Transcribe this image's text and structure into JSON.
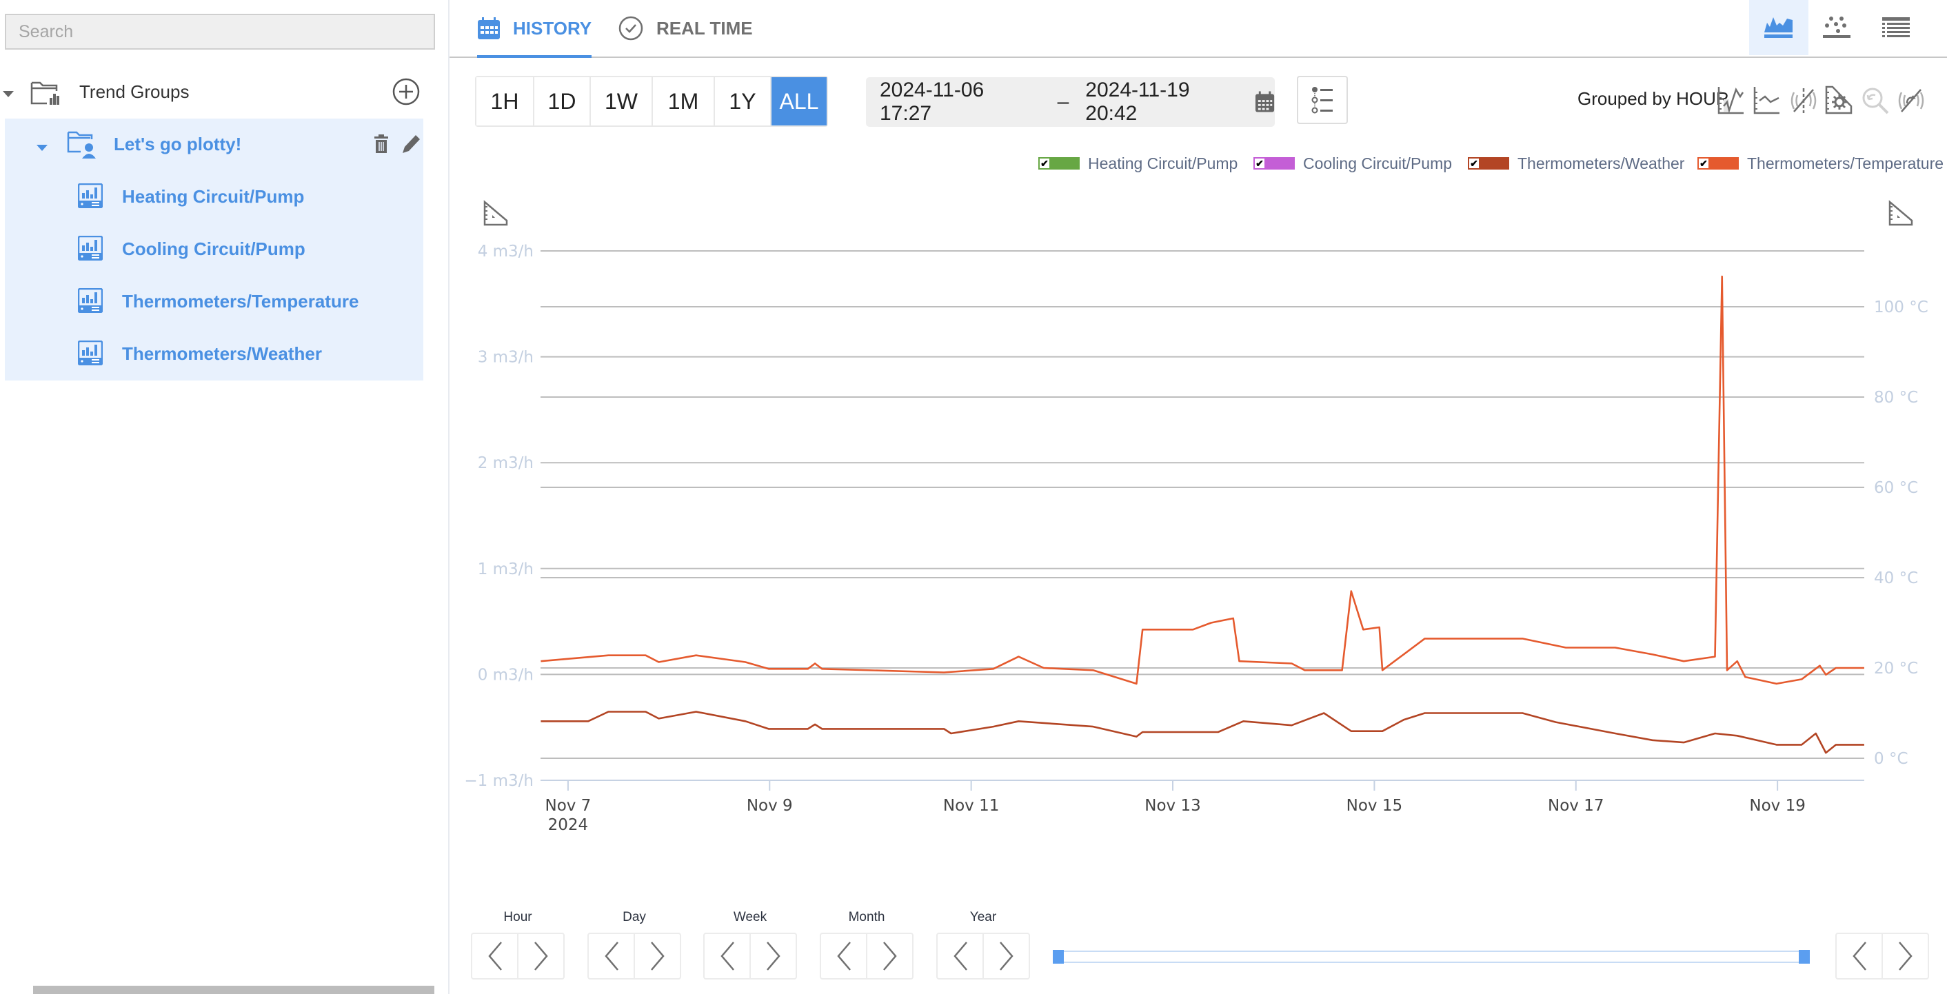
{
  "sidebar": {
    "search_placeholder": "Search",
    "root_label": "Trend Groups",
    "group": {
      "label": "Let's go plotty!",
      "items": [
        {
          "label": "Heating Circuit/Pump"
        },
        {
          "label": "Cooling Circuit/Pump"
        },
        {
          "label": "Thermometers/Temperature"
        },
        {
          "label": "Thermometers/Weather"
        }
      ]
    }
  },
  "tabs": [
    {
      "label": "HISTORY",
      "icon": "calendar-icon",
      "active": true
    },
    {
      "label": "REAL TIME",
      "icon": "clock-icon",
      "active": false
    }
  ],
  "view_modes": [
    {
      "name": "line-chart-view",
      "icon": "area-chart-icon",
      "active": true
    },
    {
      "name": "scatter-view",
      "icon": "scatter-icon",
      "active": false
    },
    {
      "name": "table-view",
      "icon": "table-icon",
      "active": false
    }
  ],
  "toolbar": {
    "ranges": [
      "1H",
      "1D",
      "1W",
      "1M",
      "1Y",
      "ALL"
    ],
    "active_range": "ALL",
    "date_from": "2024-11-06 17:27",
    "date_sep": "–",
    "date_to": "2024-11-19 20:42",
    "grouped_by": "Grouped by HOUR",
    "tools": [
      "line-interpolation-icon",
      "step-line-icon",
      "unlink-axes-icon",
      "axis-settings-icon",
      "reset-zoom-icon",
      "disable-realtime-icon"
    ]
  },
  "colors": {
    "accent": "#4a90e2",
    "heating": "#67a744",
    "cooling": "#c45ed6",
    "weather": "#b34524",
    "temperature": "#e55a2e"
  },
  "legend": [
    {
      "label": "Heating Circuit/Pump",
      "color": "#67a744",
      "checked": true
    },
    {
      "label": "Cooling Circuit/Pump",
      "color": "#c45ed6",
      "checked": true
    },
    {
      "label": "Thermometers/Weather",
      "color": "#b34524",
      "checked": true
    },
    {
      "label": "Thermometers/Temperature",
      "color": "#e55a2e",
      "checked": true
    }
  ],
  "navigation": {
    "steps": [
      "Hour",
      "Day",
      "Week",
      "Month",
      "Year"
    ],
    "slider_range": [
      0,
      1
    ]
  },
  "chart_data": {
    "type": "line",
    "title": "",
    "xlabel": "",
    "x_range_days": [
      6.727,
      19.861
    ],
    "x_ticks": [
      {
        "day": 7,
        "label": "Nov 7",
        "sub": "2024"
      },
      {
        "day": 9,
        "label": "Nov 9"
      },
      {
        "day": 11,
        "label": "Nov 11"
      },
      {
        "day": 13,
        "label": "Nov 13"
      },
      {
        "day": 15,
        "label": "Nov 15"
      },
      {
        "day": 17,
        "label": "Nov 17"
      },
      {
        "day": 19,
        "label": "Nov 19"
      }
    ],
    "y_left": {
      "unit": "m3/h",
      "range": [
        -1,
        4
      ],
      "ticks": [
        {
          "v": 4,
          "label": "4 m3/h"
        },
        {
          "v": 3,
          "label": "3 m3/h"
        },
        {
          "v": 2,
          "label": "2 m3/h"
        },
        {
          "v": 1,
          "label": "1 m3/h"
        },
        {
          "v": 0,
          "label": "0 m3/h"
        },
        {
          "v": -1,
          "label": "−1 m3/h"
        }
      ]
    },
    "y_right": {
      "unit": "°C",
      "ticks": [
        {
          "v": 100,
          "label": "100 °C"
        },
        {
          "v": 80,
          "label": "80 °C"
        },
        {
          "v": 60,
          "label": "60 °C"
        },
        {
          "v": 40,
          "label": "40 °C"
        },
        {
          "v": 20,
          "label": "20 °C"
        },
        {
          "v": 0,
          "label": "0 °C"
        }
      ]
    },
    "grid": true,
    "legend_position": "top-right",
    "series": [
      {
        "name": "Heating Circuit/Pump",
        "axis": "left",
        "color": "#67a744",
        "points": []
      },
      {
        "name": "Cooling Circuit/Pump",
        "axis": "left",
        "color": "#c45ed6",
        "points": []
      },
      {
        "name": "Thermometers/Weather",
        "axis": "right",
        "color": "#b34524",
        "points": [
          [
            6.73,
            8.2
          ],
          [
            7.2,
            8.2
          ],
          [
            7.4,
            10.3
          ],
          [
            7.77,
            10.3
          ],
          [
            7.9,
            8.8
          ],
          [
            8.27,
            10.3
          ],
          [
            8.76,
            8.2
          ],
          [
            8.99,
            6.5
          ],
          [
            9.38,
            6.5
          ],
          [
            9.45,
            7.5
          ],
          [
            9.52,
            6.5
          ],
          [
            10.73,
            6.5
          ],
          [
            10.8,
            5.5
          ],
          [
            11.22,
            7.0
          ],
          [
            11.47,
            8.2
          ],
          [
            12.21,
            7.0
          ],
          [
            12.64,
            4.8
          ],
          [
            12.7,
            5.8
          ],
          [
            13.45,
            5.8
          ],
          [
            13.7,
            8.2
          ],
          [
            14.18,
            7.3
          ],
          [
            14.5,
            10.0
          ],
          [
            14.77,
            6.0
          ],
          [
            15.08,
            6.0
          ],
          [
            15.29,
            8.5
          ],
          [
            15.5,
            10.0
          ],
          [
            16.47,
            10.0
          ],
          [
            16.8,
            8.0
          ],
          [
            17.39,
            5.5
          ],
          [
            17.76,
            4.0
          ],
          [
            18.07,
            3.5
          ],
          [
            18.38,
            5.5
          ],
          [
            18.6,
            5.0
          ],
          [
            18.99,
            3.0
          ],
          [
            19.24,
            3.0
          ],
          [
            19.38,
            5.5
          ],
          [
            19.48,
            1.2
          ],
          [
            19.58,
            3.0
          ],
          [
            19.86,
            3.0
          ]
        ]
      },
      {
        "name": "Thermometers/Temperature",
        "axis": "right",
        "color": "#e55a2e",
        "points": [
          [
            6.73,
            21.5
          ],
          [
            7.4,
            22.8
          ],
          [
            7.77,
            22.8
          ],
          [
            7.9,
            21.3
          ],
          [
            8.27,
            22.8
          ],
          [
            8.76,
            21.3
          ],
          [
            8.99,
            19.8
          ],
          [
            9.38,
            19.8
          ],
          [
            9.45,
            21.0
          ],
          [
            9.52,
            19.8
          ],
          [
            10.73,
            19.0
          ],
          [
            11.22,
            19.8
          ],
          [
            11.47,
            22.5
          ],
          [
            11.72,
            20.0
          ],
          [
            12.21,
            19.5
          ],
          [
            12.64,
            16.5
          ],
          [
            12.7,
            28.5
          ],
          [
            13.2,
            28.5
          ],
          [
            13.38,
            30.0
          ],
          [
            13.6,
            31.0
          ],
          [
            13.66,
            21.5
          ],
          [
            14.18,
            21.0
          ],
          [
            14.31,
            19.5
          ],
          [
            14.68,
            19.5
          ],
          [
            14.77,
            37.0
          ],
          [
            14.89,
            28.5
          ],
          [
            15.05,
            29.0
          ],
          [
            15.08,
            19.5
          ],
          [
            15.29,
            23.0
          ],
          [
            15.5,
            26.5
          ],
          [
            16.47,
            26.5
          ],
          [
            16.9,
            24.5
          ],
          [
            17.39,
            24.5
          ],
          [
            17.76,
            23.0
          ],
          [
            18.07,
            21.5
          ],
          [
            18.38,
            22.5
          ],
          [
            18.45,
            106.7
          ],
          [
            18.5,
            19.5
          ],
          [
            18.6,
            21.5
          ],
          [
            18.68,
            18.0
          ],
          [
            18.99,
            16.5
          ],
          [
            19.24,
            17.5
          ],
          [
            19.42,
            20.5
          ],
          [
            19.48,
            18.5
          ],
          [
            19.58,
            20.0
          ],
          [
            19.86,
            20.0
          ]
        ]
      }
    ]
  }
}
